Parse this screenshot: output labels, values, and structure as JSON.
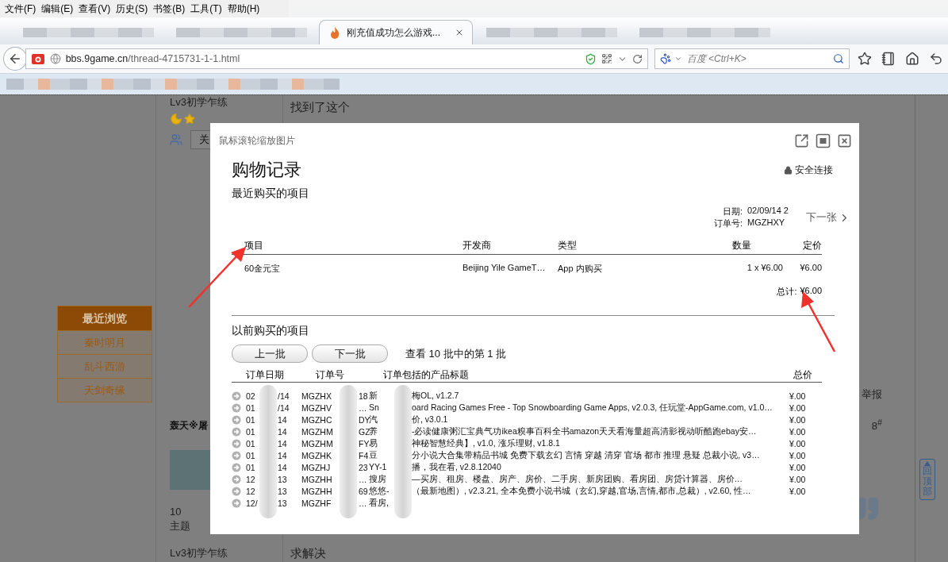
{
  "menu": [
    "文件(F)",
    "编辑(E)",
    "查看(V)",
    "历史(S)",
    "书签(B)",
    "工具(T)",
    "帮助(H)"
  ],
  "tabs": [
    {
      "kind": "blurred",
      "selected": false
    },
    {
      "kind": "blurred",
      "selected": false
    },
    {
      "kind": "page",
      "label": "刚充值成功怎么游戏...",
      "selected": true
    },
    {
      "kind": "blurred",
      "selected": false
    },
    {
      "kind": "blurred",
      "selected": false
    }
  ],
  "address": {
    "host": "bbs.9game.cn",
    "path": "/thread-4715731-1-1.html"
  },
  "search": {
    "placeholder": "百度 <Ctrl+K>"
  },
  "page": {
    "recent": {
      "title": "最近浏览",
      "items": [
        "秦时明月",
        "乱斗西游",
        "天剑奇缘"
      ]
    },
    "author": {
      "rank": "Lv3初学乍练",
      "follow_button": "关"
    },
    "post_text": "找到了这个",
    "next_author": {
      "name": "轰天※屠",
      "stat_value": "10",
      "stat_label": "主题",
      "rank": "Lv3初学乍练"
    },
    "report": "举报",
    "floor": "8$^{#}$",
    "reply_text": "求解决",
    "back_to_top": "回顶部"
  },
  "modal": {
    "hint": "鼠标滚轮缩放图片",
    "title": "购物记录",
    "secure": "安全连接",
    "recent_heading": "最近购买的项目",
    "date_label": "日期:",
    "date_value": "02/09/14 2",
    "order_label": "订单号:",
    "order_value": "MGZHXY",
    "next": "下一张",
    "columns": [
      "项目",
      "开发商",
      "类型",
      "数量",
      "定价"
    ],
    "items": [
      {
        "item": "60金元宝",
        "developer": "Beijing Yile GameT…",
        "type": "App 内购买",
        "quantity": "1 x ¥6.00",
        "price": "¥6.00"
      }
    ],
    "total_label": "总计:",
    "total_value": "¥6.00",
    "previous_heading": "以前购买的项目",
    "prev_button": "上一批",
    "next_button": "下一批",
    "batch_info": "查看 10 批中的第 1 批",
    "history_columns": [
      "订单日期",
      "订单号",
      "订单包括的产品标题",
      "总价"
    ],
    "orders": [
      {
        "date": [
          "02",
          "/14"
        ],
        "order_no": [
          "MGZHX",
          "18"
        ],
        "title": [
          "新",
          "梅OL, v1.2.7"
        ],
        "total": "¥.00"
      },
      {
        "date": [
          "01",
          "/14"
        ],
        "order_no": [
          "MGZHV",
          "…"
        ],
        "title": [
          "Sn",
          "oard Racing Games Free - Top Snowboarding Game Apps, v2.0.3, 任玩堂-AppGame.com, v1.0…"
        ],
        "total": "¥.00"
      },
      {
        "date": [
          "01",
          "14"
        ],
        "order_no": [
          "MGZHC",
          "DY"
        ],
        "title": [
          "汽",
          "价, v3.0.1"
        ],
        "total": "¥.00"
      },
      {
        "date": [
          "01",
          "14"
        ],
        "order_no": [
          "MGZHM",
          "GZ"
        ],
        "title": [
          "养",
          "-必读健康粥汇宝典气功ikea糗事百科全书amazon天天看海量超高清影视动听酷跑ebay安…"
        ],
        "total": "¥.00"
      },
      {
        "date": [
          "01",
          "14"
        ],
        "order_no": [
          "MGZHM",
          "FY"
        ],
        "title": [
          "易",
          "神秘智慧经典】, v1.0, 涨乐理财, v1.8.1"
        ],
        "total": "¥.00"
      },
      {
        "date": [
          "01",
          "14"
        ],
        "order_no": [
          "MGZHK",
          "F4"
        ],
        "title": [
          "豆",
          "分小说大合集带精品书城 免费下载玄幻 言情 穿越 清穿 官场 都市 推理 悬疑 总裁小说, v3…"
        ],
        "total": "¥.00"
      },
      {
        "date": [
          "01",
          "14"
        ],
        "order_no": [
          "MGZHJ",
          "23"
        ],
        "title": [
          "YY-1",
          "播，我在看, v2.8.12040"
        ],
        "total": "¥.00"
      },
      {
        "date": [
          "12",
          "13"
        ],
        "order_no": [
          "MGZHH",
          "…"
        ],
        "title": [
          "搜房",
          "—买房、租房、楼盘、房产、房价、二手房、新房团购、看房团、房贷计算器、房价…"
        ],
        "total": "¥.00"
      },
      {
        "date": [
          "12",
          "13"
        ],
        "order_no": [
          "MGZHH",
          "69"
        ],
        "title": [
          "悠悠-",
          "（最新地图）, v2.3.21, 全本免费小说书城（玄幻,穿越,官场,言情,都市,总裁）, v2.60, 性…"
        ],
        "total": "¥.00"
      },
      {
        "date": [
          "12/",
          "13"
        ],
        "order_no": [
          "MGZHF",
          "…"
        ],
        "title": [
          "看房,"
        ]
      }
    ]
  }
}
